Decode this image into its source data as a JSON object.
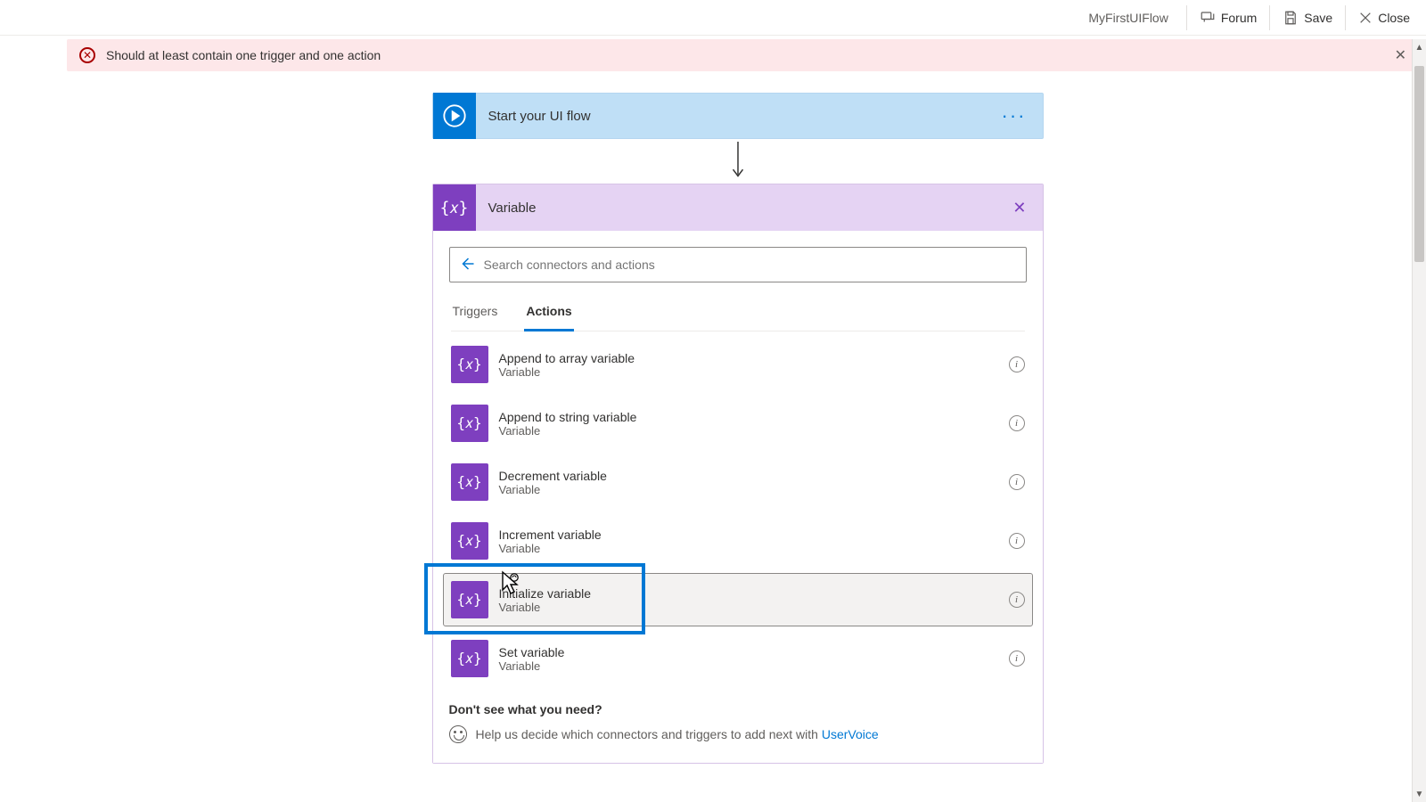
{
  "toolbar": {
    "flow_name": "MyFirstUIFlow",
    "forum_label": "Forum",
    "save_label": "Save",
    "close_label": "Close"
  },
  "alert": {
    "text": "Should at least contain one trigger and one action"
  },
  "start_step": {
    "label": "Start your UI flow"
  },
  "variable_card": {
    "title": "Variable",
    "search_placeholder": "Search connectors and actions",
    "tabs": {
      "triggers": "Triggers",
      "actions": "Actions"
    },
    "actions": [
      {
        "title": "Append to array variable",
        "sub": "Variable"
      },
      {
        "title": "Append to string variable",
        "sub": "Variable"
      },
      {
        "title": "Decrement variable",
        "sub": "Variable"
      },
      {
        "title": "Increment variable",
        "sub": "Variable"
      },
      {
        "title": "Initialize variable",
        "sub": "Variable"
      },
      {
        "title": "Set variable",
        "sub": "Variable"
      }
    ],
    "footer": {
      "question": "Don't see what you need?",
      "help_prefix": "Help us decide which connectors and triggers to add next with ",
      "uservoice": "UserVoice"
    }
  },
  "icon_glyph": "{𝑥}"
}
